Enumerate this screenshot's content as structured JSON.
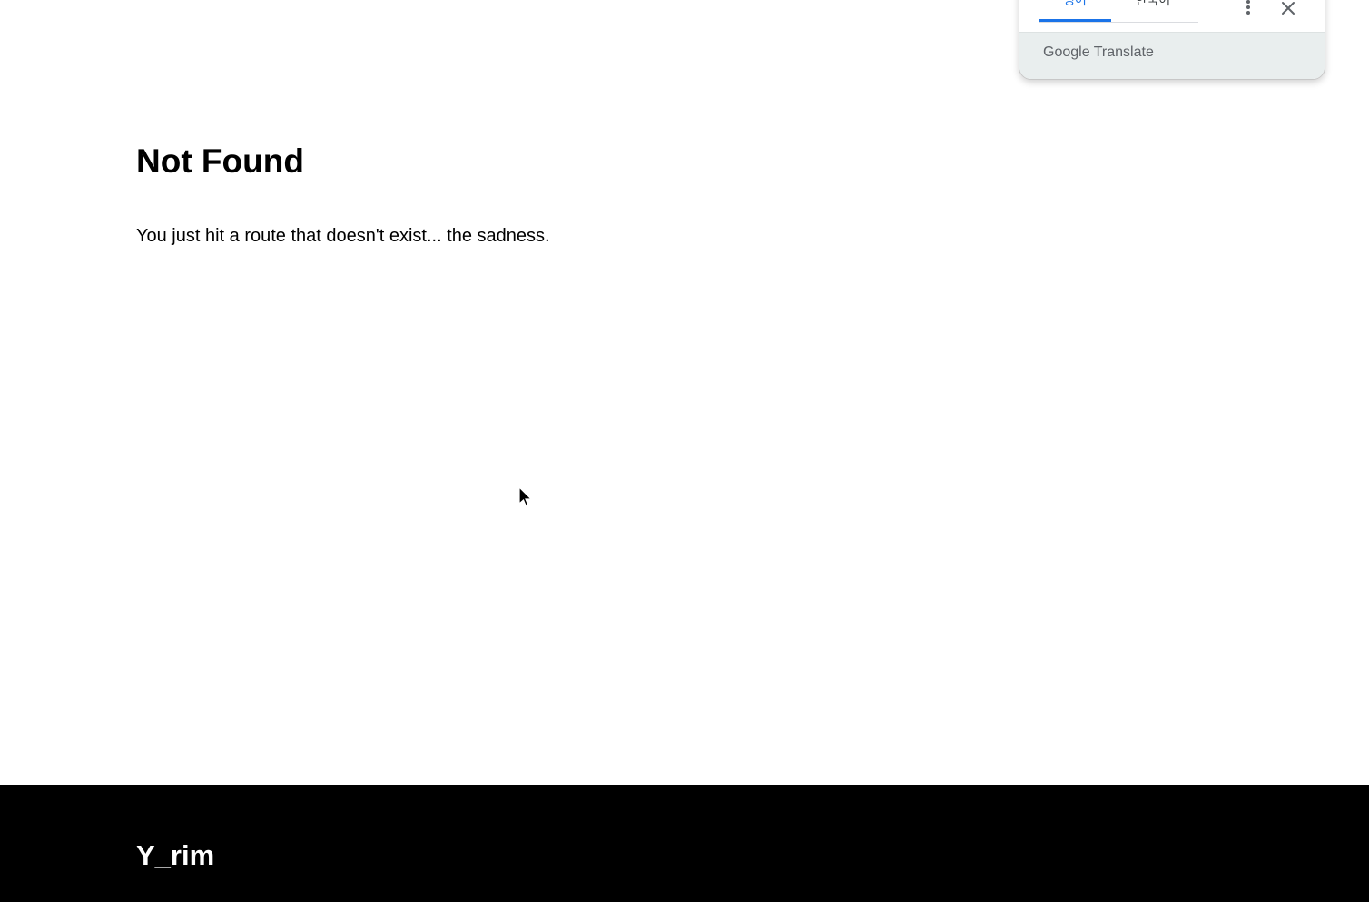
{
  "main": {
    "title": "Not Found",
    "message": "You just hit a route that doesn't exist... the sadness."
  },
  "footer": {
    "brand": "Y_rim"
  },
  "translate_popup": {
    "tabs": [
      {
        "label": "영어",
        "active": true
      },
      {
        "label": "한국어",
        "active": false
      }
    ],
    "brand_google": "Google",
    "brand_translate": "Translate",
    "icons": {
      "more": "more-vert-icon",
      "close": "close-icon"
    },
    "colors": {
      "accent": "#1a73e8",
      "footer_bg": "#e9eeee"
    }
  },
  "colors": {
    "page_bg": "#ffffff",
    "footer_bg": "#000000",
    "footer_text": "#ffffff"
  }
}
